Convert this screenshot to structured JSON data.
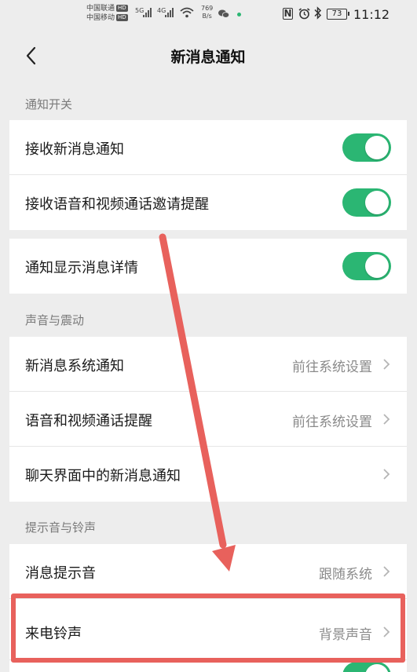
{
  "status_bar": {
    "carrier1": "中国联通",
    "carrier2": "中国移动",
    "hd": "HD",
    "network1": "5G",
    "network2": "4G",
    "speed_value": "769",
    "speed_unit": "B/s",
    "nfc": "N",
    "battery": "73",
    "time": "11:12"
  },
  "header": {
    "title": "新消息通知"
  },
  "sections": {
    "notify": {
      "title": "通知开关",
      "rows": [
        {
          "label": "接收新消息通知",
          "toggle_on": true
        },
        {
          "label": "接收语音和视频通话邀请提醒",
          "toggle_on": true
        },
        {
          "label": "通知显示消息详情",
          "toggle_on": true
        }
      ]
    },
    "sound": {
      "title": "声音与震动",
      "rows": [
        {
          "label": "新消息系统通知",
          "value": "前往系统设置"
        },
        {
          "label": "语音和视频通话提醒",
          "value": "前往系统设置"
        },
        {
          "label": "聊天界面中的新消息通知",
          "value": ""
        }
      ]
    },
    "ringtone": {
      "title": "提示音与铃声",
      "rows": [
        {
          "label": "消息提示音",
          "value": "跟随系统"
        },
        {
          "label": "来电铃声",
          "value": "背景声音"
        }
      ]
    }
  },
  "colors": {
    "accent_green": "#2bb673",
    "annotation_red": "#e8615c",
    "background": "#ededed"
  }
}
